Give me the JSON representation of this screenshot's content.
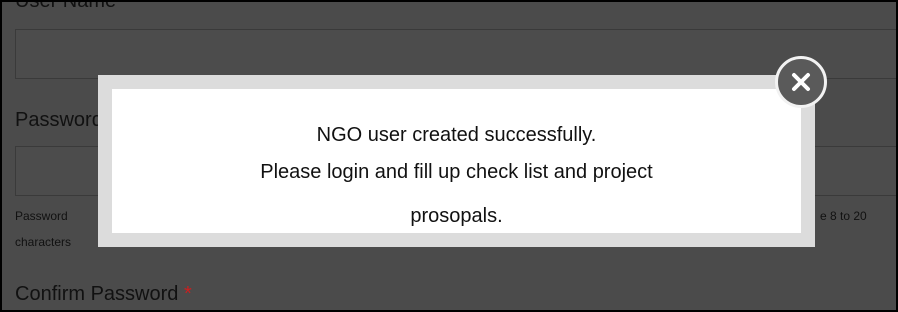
{
  "form": {
    "username_label": "User Name",
    "password_label": "Password",
    "password_hint_left_line1": "Password",
    "password_hint_left_line2": "characters",
    "password_hint_right": "e 8 to 20",
    "confirm_password_label": "Confirm Password",
    "required_mark": "*"
  },
  "modal": {
    "line1": "NGO user created successfully.",
    "line2": "Please login and fill up check list and project",
    "line3": "prosopals.",
    "close_icon": "close-icon"
  },
  "colors": {
    "overlay_bg": "#4b4b4b",
    "modal_bg": "#ffffff",
    "modal_border": "#dcdcdc",
    "required": "#cc1f1f",
    "close_button": "#5a5a5a"
  }
}
